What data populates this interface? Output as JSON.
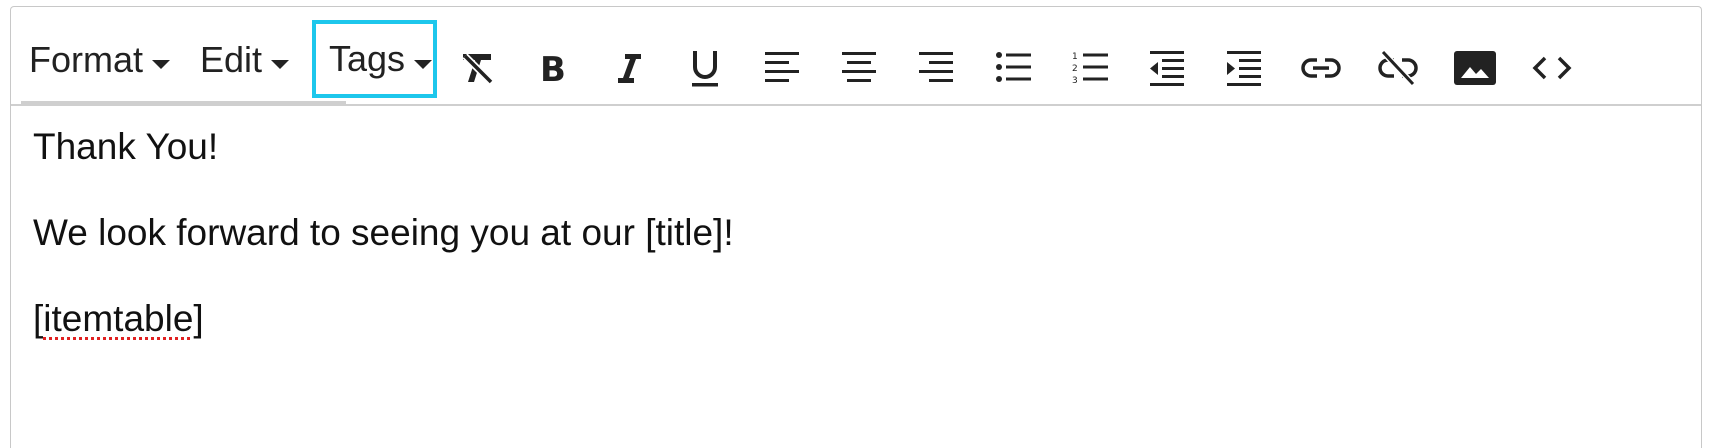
{
  "menus": [
    {
      "label": "Format"
    },
    {
      "label": "Edit"
    },
    {
      "label": "Tags"
    }
  ],
  "tools": [
    {
      "name": "clear-format-icon"
    },
    {
      "name": "bold-icon"
    },
    {
      "name": "italic-icon"
    },
    {
      "name": "underline-icon"
    },
    {
      "name": "align-left-icon"
    },
    {
      "name": "align-center-icon"
    },
    {
      "name": "align-right-icon"
    },
    {
      "name": "bullet-list-icon"
    },
    {
      "name": "numbered-list-icon"
    },
    {
      "name": "outdent-icon"
    },
    {
      "name": "indent-icon"
    },
    {
      "name": "link-icon"
    },
    {
      "name": "unlink-icon"
    },
    {
      "name": "image-icon"
    },
    {
      "name": "code-icon"
    }
  ],
  "highlight_color": "#1dc7ec",
  "content": {
    "line1": "Thank You!",
    "line2": "We look forward to seeing you at our [title]!",
    "line3_open": "[",
    "line3_word": "itemtable",
    "line3_close": "]"
  }
}
